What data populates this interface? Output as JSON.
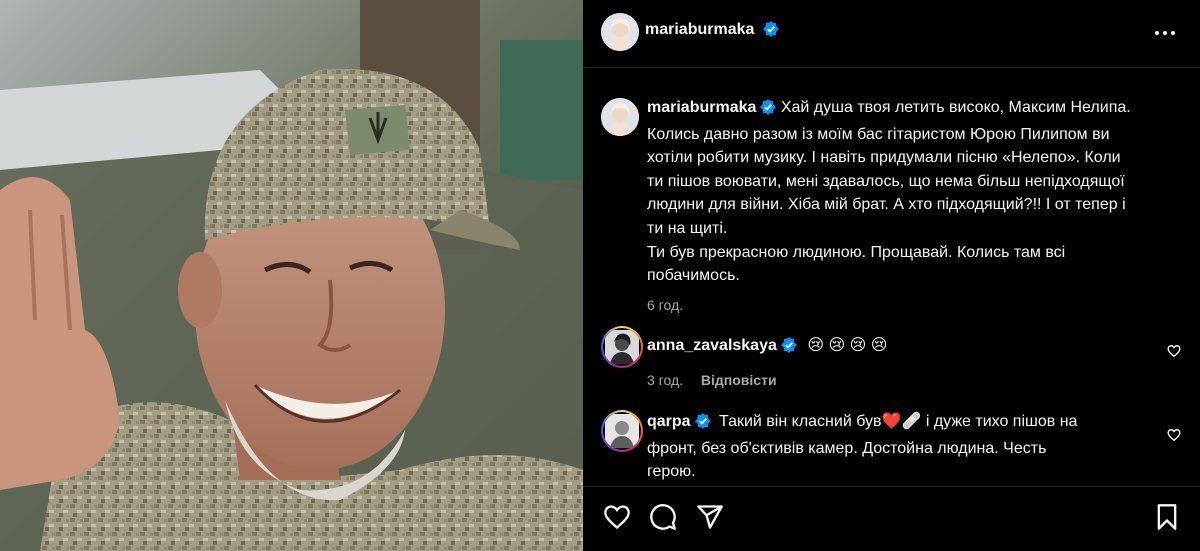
{
  "colors": {
    "background": "#000000",
    "verified": "#0095f6",
    "text": "#f5f5f5",
    "muted": "#a8a8a8"
  },
  "header": {
    "username": "mariaburmaka"
  },
  "caption": {
    "username": "mariaburmaka",
    "lines": [
      "Хай душа твоя летить високо, Максим Нелипа.",
      "Колись давно разом із моїм бас гітаристом Юрою Пилипом ви",
      "хотіли робити музику. І навіть придумали пісню «Нелепо». Коли",
      "ти пішов воювати, мені здавалось, що нема більш непідходящої",
      "людини для війни. Хіба мій брат. А хто підходящий?!! І от тепер і",
      "ти на щиті.",
      "Ти був прекрасною людиною. Прощавай. Колись там всі",
      "побачимось."
    ],
    "time": "6 год."
  },
  "comments": [
    {
      "username": "anna_zavalskaya",
      "text": "😢 😢 😢 😢",
      "time": "3 год.",
      "reply": "Відповісти"
    },
    {
      "username": "qarpa",
      "text_lines": [
        "Такий він класний був❤️🩹 і дуже тихо пішов на",
        "фронт, без об'єктивів камер. Достойна людина. Честь",
        "герою."
      ]
    }
  ],
  "icons": {
    "more": "more-horizontal-icon",
    "like": "heart-icon",
    "comment": "comment-icon",
    "share": "share-icon",
    "save": "bookmark-icon",
    "verified": "verified-badge-icon"
  }
}
